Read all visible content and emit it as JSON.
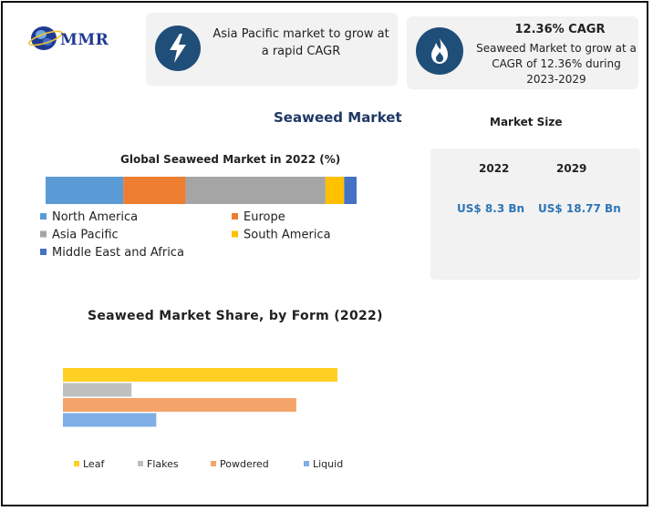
{
  "logo": {
    "text": "MMR"
  },
  "cards": {
    "asia": {
      "text": "Asia Pacific market to grow at a rapid CAGR",
      "icon": "lightning-icon"
    },
    "cagr": {
      "title": "12.36% CAGR",
      "text": "Seaweed Market to grow at a CAGR of 12.36% during 2023-2029",
      "icon": "flame-icon"
    }
  },
  "main_title": "Seaweed Market",
  "market_size": {
    "title": "Market Size",
    "years": [
      "2022",
      "2029"
    ],
    "values": [
      "US$ 8.3 Bn",
      "US$ 18.77 Bn"
    ]
  },
  "colors": {
    "accent": "#1f4e79",
    "value_blue": "#2e75b6",
    "north_america": "#5b9bd5",
    "europe": "#ed7d31",
    "asia_pacific": "#a5a5a5",
    "south_america": "#ffc000",
    "mea": "#4472c4"
  },
  "chart_data": [
    {
      "type": "bar",
      "orientation": "horizontal-stacked",
      "title": "Global Seaweed Market in 2022 (%)",
      "series": [
        {
          "name": "North America",
          "values": [
            25
          ],
          "color": "#5b9bd5"
        },
        {
          "name": "Europe",
          "values": [
            20
          ],
          "color": "#ed7d31"
        },
        {
          "name": "Asia Pacific",
          "values": [
            45
          ],
          "color": "#a5a5a5"
        },
        {
          "name": "South America",
          "values": [
            6
          ],
          "color": "#ffc000"
        },
        {
          "name": "Middle East and Africa",
          "values": [
            4
          ],
          "color": "#4472c4"
        }
      ],
      "legend_placement": "bottom"
    },
    {
      "type": "bar",
      "orientation": "horizontal",
      "title": "Seaweed Market Share, by Form (2022)",
      "categories": [
        "Leaf",
        "Flakes",
        "Powdered",
        "Liquid"
      ],
      "values": [
        50,
        12.5,
        42.5,
        17
      ],
      "colors": [
        "#ffd024",
        "#bfbfbf",
        "#f4a46a",
        "#7fafe6"
      ],
      "legend_placement": "bottom"
    }
  ]
}
